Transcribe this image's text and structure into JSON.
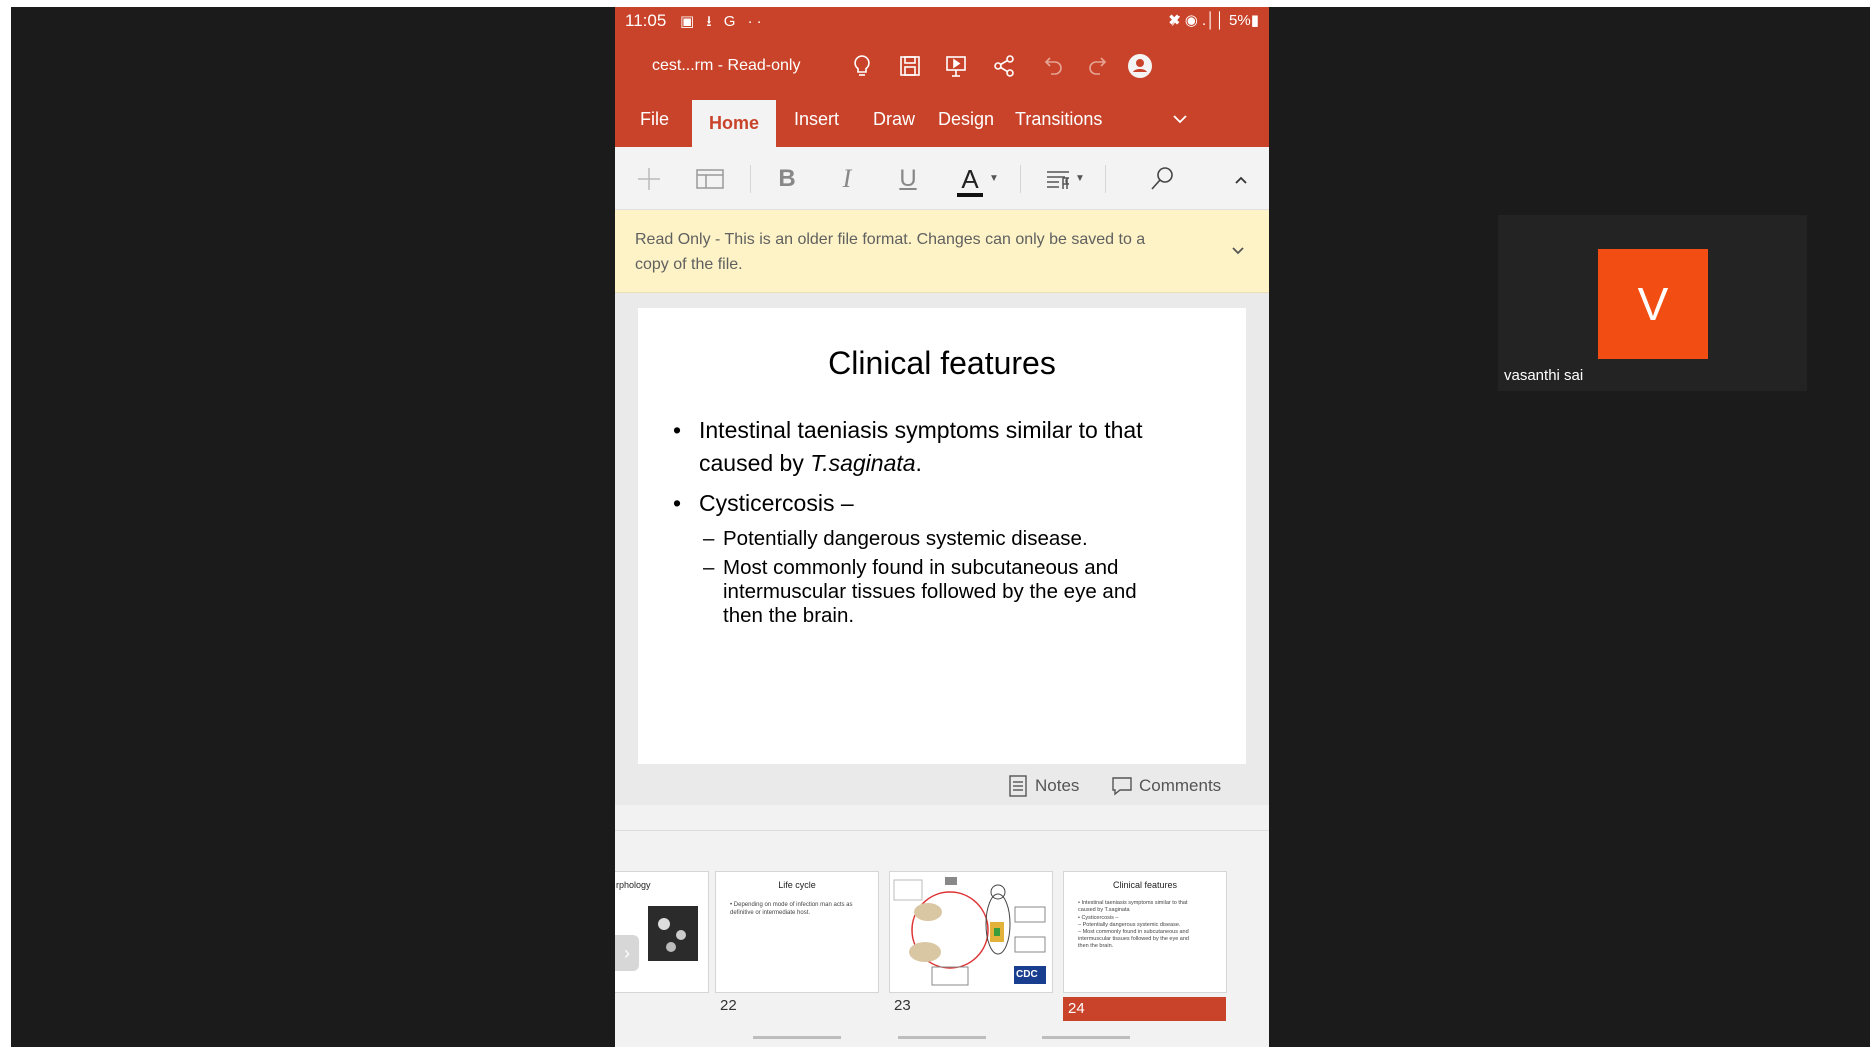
{
  "status_bar": {
    "time": "11:05",
    "left_icons": "▣ ⭳ G ··",
    "right_icons": "✖̷ ◉ .││ 5%▮"
  },
  "app": {
    "doc_title": "cest...rm - Read-only",
    "toolbar_icons": [
      "lightbulb-icon",
      "save-icon",
      "present-icon",
      "share-icon",
      "undo-icon",
      "redo-icon",
      "account-icon"
    ],
    "tabs": [
      {
        "label": "File"
      },
      {
        "label": "Home"
      },
      {
        "label": "Insert"
      },
      {
        "label": "Draw"
      },
      {
        "label": "Design"
      },
      {
        "label": "Transitions"
      }
    ],
    "active_tab": "Home",
    "ribbon": {
      "bold": "B",
      "italic": "I",
      "underline": "U",
      "font_color": "A"
    }
  },
  "notice": {
    "text": "Read Only - This is an older file format. Changes can only be saved to a copy of the file."
  },
  "slide": {
    "title": "Clinical features",
    "bullet1_line1": "Intestinal taeniasis symptoms similar to that",
    "bullet1_line2_prefix": "caused by ",
    "bullet1_line2_italic": "T.saginata",
    "bullet1_line2_suffix": ".",
    "bullet2": "Cysticercosis –",
    "sub1": "Potentially dangerous systemic disease.",
    "sub2_line1": "Most commonly found in subcutaneous and",
    "sub2_line2": "intermuscular tissues followed by the eye and",
    "sub2_line3": "then the brain."
  },
  "notes_bar": {
    "notes_label": "Notes",
    "comments_label": "Comments"
  },
  "thumbnails": [
    {
      "num": "",
      "title": "rphology"
    },
    {
      "num": "22",
      "title": "Life cycle",
      "line1": "• Depending on mode of infection man acts as",
      "line2": "   definitive or intermediate host."
    },
    {
      "num": "23",
      "title": "",
      "logo": "CDC"
    },
    {
      "num": "24",
      "title": "Clinical features",
      "line1": "• Intestinal taeniasis symptoms similar to that",
      "line2": "   caused by T.saginata",
      "line3": "• Cysticercosis –",
      "line4": "  – Potentially dangerous systemic disease.",
      "line5": "  – Most commonly found in subcutaneous and",
      "line6": "    intermuscular tissues followed by the eye and",
      "line7": "    then the brain."
    }
  ],
  "participant": {
    "initial": "V",
    "name": "vasanthi sai",
    "avatar_color": "#f24d12"
  },
  "colors": {
    "accent": "#c9432a",
    "notice_bg": "#fdf3c6",
    "background": "#1b1b1b"
  }
}
